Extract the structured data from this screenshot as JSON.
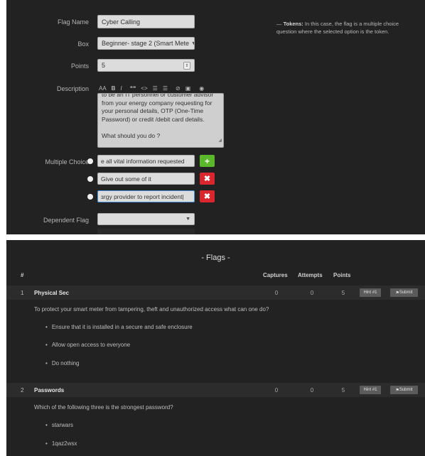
{
  "form": {
    "flag_name_label": "Flag Name",
    "flag_name_value": "Cyber Calling",
    "box_label": "Box",
    "box_value": "Beginner- stage 2 (Smart Mete",
    "points_label": "Points",
    "points_value": "5",
    "description_label": "Description",
    "toolbar": [
      "AA",
      "B",
      "I",
      "❝❝",
      "<>",
      "☰",
      "☰",
      "⊘",
      "▣",
      "◉"
    ],
    "description_lines": [
      "to be an IT personnel or customer advisor",
      "from your energy company requesting for",
      "your personal details, OTP (One-Time",
      "Password) or credit /debit card details.",
      "",
      "What should you do ?"
    ],
    "multiple_choice_label": "Multiple Choice",
    "choices": [
      "e all vital information requested",
      "Give out some of it",
      "ɜrgy provider to report incident|"
    ],
    "add_symbol": "+",
    "delete_symbol": "✖",
    "dependent_flag_label": "Dependent Flag",
    "dependent_flag_value": "",
    "tokens_title": "Tokens:",
    "tokens_text": "In this case, the flag is a multiple choice question where the selected option is the token.",
    "tokens_dash": "—"
  },
  "flags": {
    "title": "- Flags -",
    "headers": {
      "num": "#",
      "captures": "Captures",
      "attempts": "Attempts",
      "points": "Points"
    },
    "hint_label": "Hint #1",
    "submit_label": "Submit",
    "items": [
      {
        "num": "1",
        "name": "Physical Sec",
        "captures": "0",
        "attempts": "0",
        "points": "5",
        "question": "To protect your smart meter from tampering, theft and unauthorized access what can one do?",
        "options": [
          "Ensure that it is installed in a secure and safe enclosure",
          "Allow open access to everyone",
          "Do nothing"
        ]
      },
      {
        "num": "2",
        "name": "Passwords",
        "captures": "0",
        "attempts": "0",
        "points": "5",
        "question": "Which of the following three is the strongest password?",
        "options": [
          "starwars",
          "1qaz2wsx"
        ]
      }
    ]
  },
  "colors": {
    "panel_bg": "#222222",
    "add_green": "#5cb82b",
    "delete_red": "#d9262f",
    "focus_blue": "#4a90d9"
  }
}
